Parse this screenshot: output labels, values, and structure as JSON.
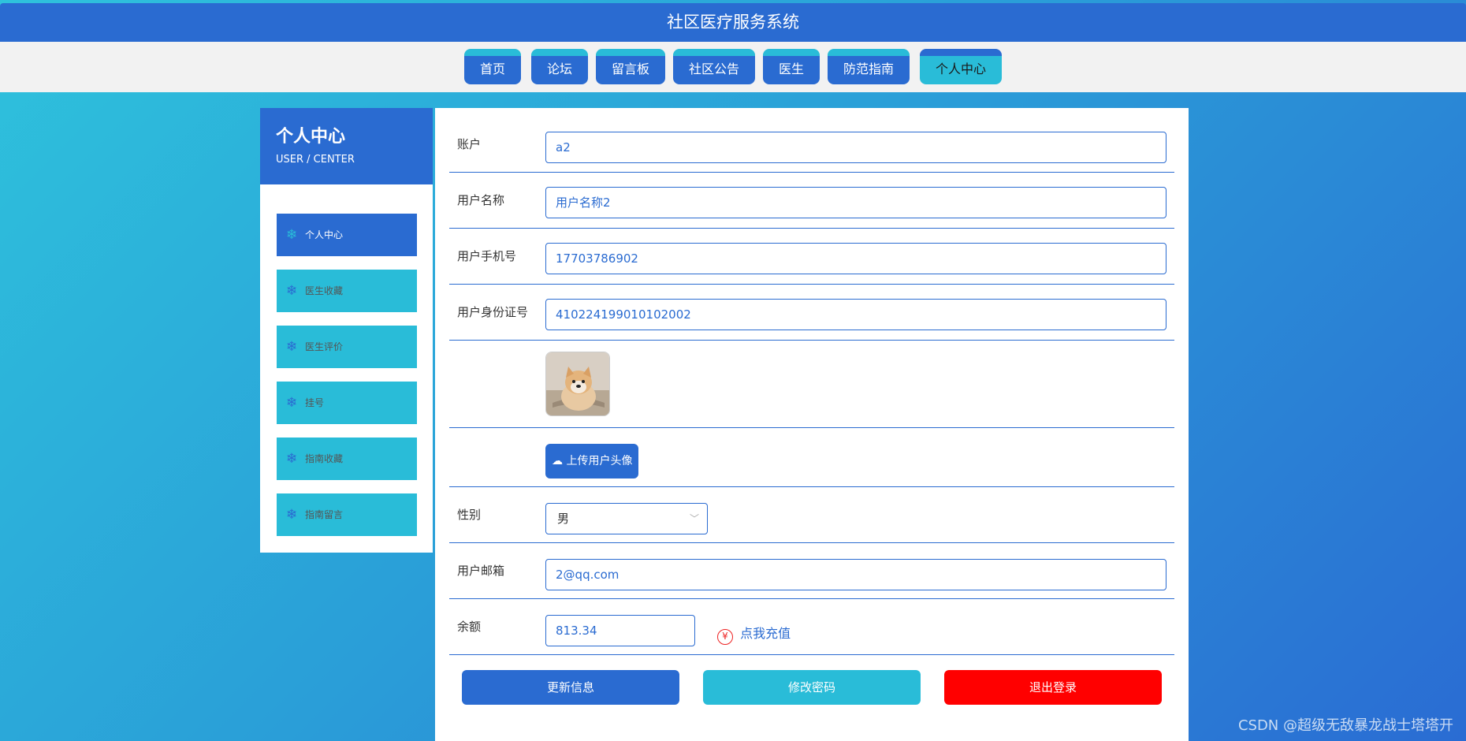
{
  "header": {
    "title": "社区医疗服务系统"
  },
  "nav": {
    "items": [
      {
        "label": "首页"
      },
      {
        "label": "论坛"
      },
      {
        "label": "留言板"
      },
      {
        "label": "社区公告"
      },
      {
        "label": "医生"
      },
      {
        "label": "防范指南"
      },
      {
        "label": "个人中心",
        "active": true
      }
    ]
  },
  "sidebar": {
    "title": "个人中心",
    "subtitle": "USER / CENTER",
    "items": [
      {
        "label": "个人中心",
        "active": true
      },
      {
        "label": "医生收藏"
      },
      {
        "label": "医生评价"
      },
      {
        "label": "挂号"
      },
      {
        "label": "指南收藏"
      },
      {
        "label": "指南留言"
      }
    ]
  },
  "form": {
    "account": {
      "label": "账户",
      "value": "a2"
    },
    "username": {
      "label": "用户名称",
      "value": "用户名称2"
    },
    "phone": {
      "label": "用户手机号",
      "value": "17703786902"
    },
    "idcard": {
      "label": "用户身份证号",
      "value": "410224199010102002"
    },
    "upload_label": "上传用户头像",
    "gender": {
      "label": "性别",
      "value": "男"
    },
    "email": {
      "label": "用户邮箱",
      "value": "2@qq.com"
    },
    "balance": {
      "label": "余额",
      "value": "813.34",
      "recharge_label": "点我充值"
    }
  },
  "actions": {
    "update_label": "更新信息",
    "password_label": "修改密码",
    "logout_label": "退出登录"
  },
  "watermark": "CSDN @超级无敌暴龙战士塔塔开",
  "colors": {
    "primary": "#2a6bd1",
    "accent": "#29bcd8",
    "danger": "#ff0000"
  }
}
